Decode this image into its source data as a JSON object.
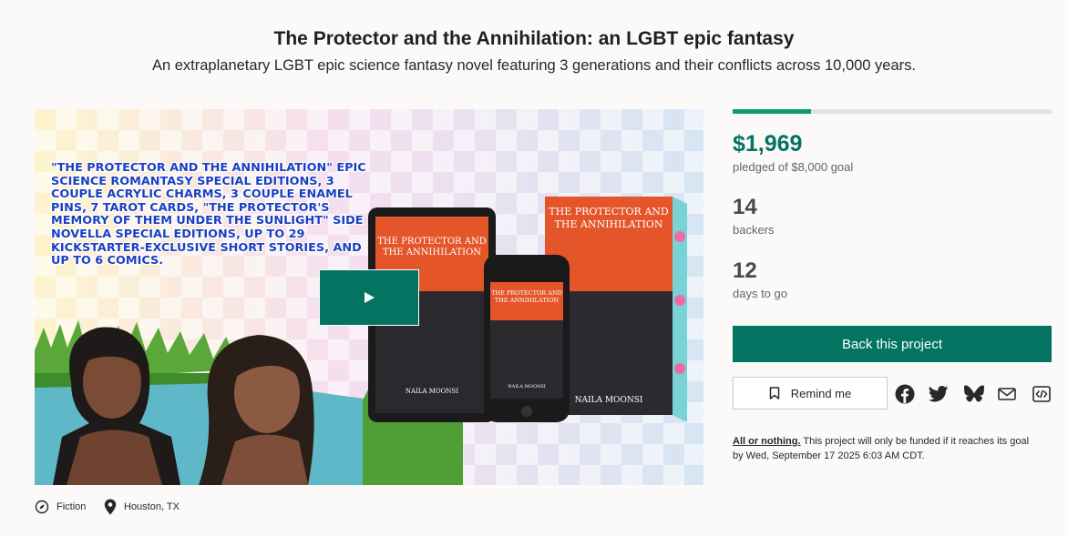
{
  "header": {
    "title": "The Protector and the Annihilation: an LGBT epic fantasy",
    "subtitle": "An extraplanetary LGBT epic science fantasy novel featuring 3 generations and their conflicts across 10,000 years."
  },
  "media": {
    "promo_text": "\"The Protector and the Annihilation\" epic science romantasy special editions, 3 couple acrylic charms, 3 couple enamel pins, 7 tarot cards, \"The Protector's memory of them under the sunlight\" side novella special editions, up to 29 Kickstarter-exclusive short stories, and up to 6 comics.",
    "book_title_line1": "THE PROTECTOR AND",
    "book_title_line2": "THE ANNIHILATION",
    "author": "NAILA MOONSI",
    "play_icon": "play-icon"
  },
  "meta": {
    "category": "Fiction",
    "location": "Houston, TX",
    "category_icon": "compass-icon",
    "location_icon": "map-pin-icon"
  },
  "campaign": {
    "progress_fraction": 0.246,
    "pledged": "$1,969",
    "pledged_label": "pledged of $8,000 goal",
    "backers": "14",
    "backers_label": "backers",
    "days": "12",
    "days_label": "days to go"
  },
  "actions": {
    "back_label": "Back this project",
    "remind_label": "Remind me",
    "share_icons": [
      "facebook-icon",
      "twitter-icon",
      "bluesky-icon",
      "email-icon",
      "embed-icon"
    ]
  },
  "note": {
    "strong": "All or nothing.",
    "text_part1": " This project will only be funded if it reaches its goal",
    "text_part2": "by Wed, September 17 2025 6:03 AM CDT."
  },
  "colors": {
    "brand": "#037362",
    "progress": "#0f9c6c",
    "background": "#fbfaf8"
  }
}
